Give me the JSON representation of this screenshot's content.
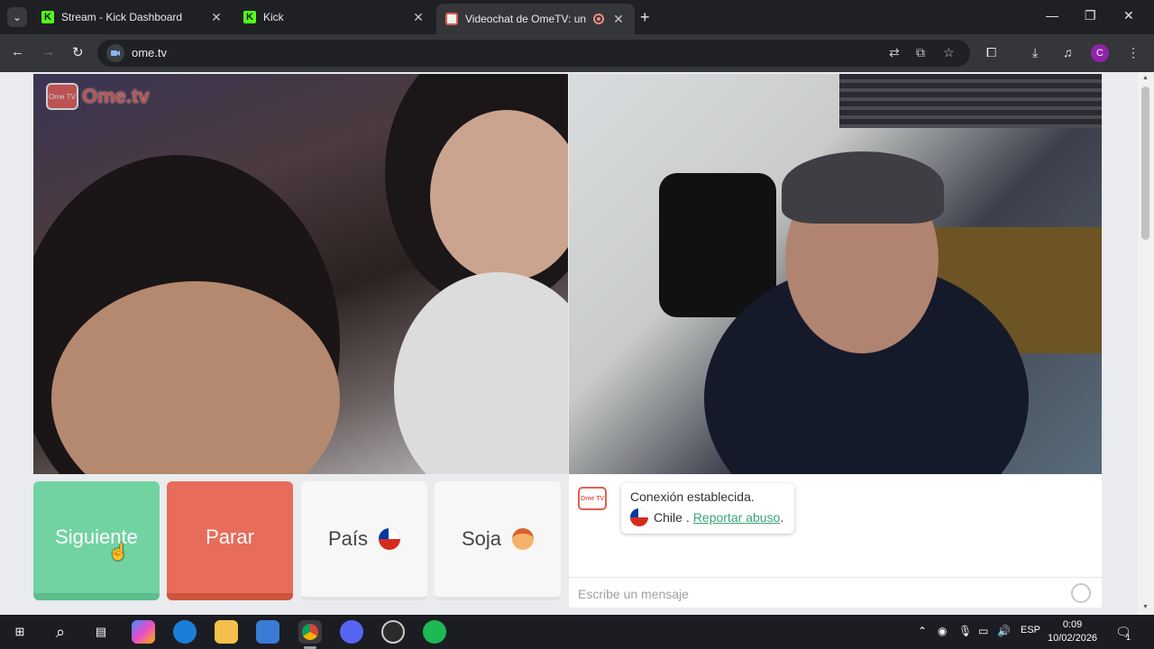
{
  "browser": {
    "tabs": [
      {
        "title": "Stream - Kick Dashboard",
        "favicon": "kick-icon"
      },
      {
        "title": "Kick",
        "favicon": "kick-icon"
      },
      {
        "title": "Videochat de OmeTV: una a",
        "favicon": "ometv-icon",
        "recording": true,
        "active": true
      }
    ],
    "url": "ome.tv",
    "profile_initial": "C"
  },
  "page": {
    "logo_text": "Ome.tv",
    "logo_badge": "Ome TV",
    "buttons": {
      "next": "Siguiente",
      "stop": "Parar",
      "country": "País",
      "gender": "Soja"
    },
    "chat": {
      "logo_text": "Ome TV",
      "status": "Conexión establecida.",
      "country": "Chile",
      "separator": ".",
      "report_link": "Reportar abuso",
      "report_suffix": ".",
      "input_placeholder": "Escribe un mensaje"
    }
  },
  "taskbar": {
    "language": "ESP",
    "time": "0:09",
    "date": "10/02/2026",
    "notifications": "1"
  },
  "colors": {
    "next": "#72d3a2",
    "stop": "#e86c5a",
    "brand": "#e45d53",
    "link": "#3aa572"
  }
}
